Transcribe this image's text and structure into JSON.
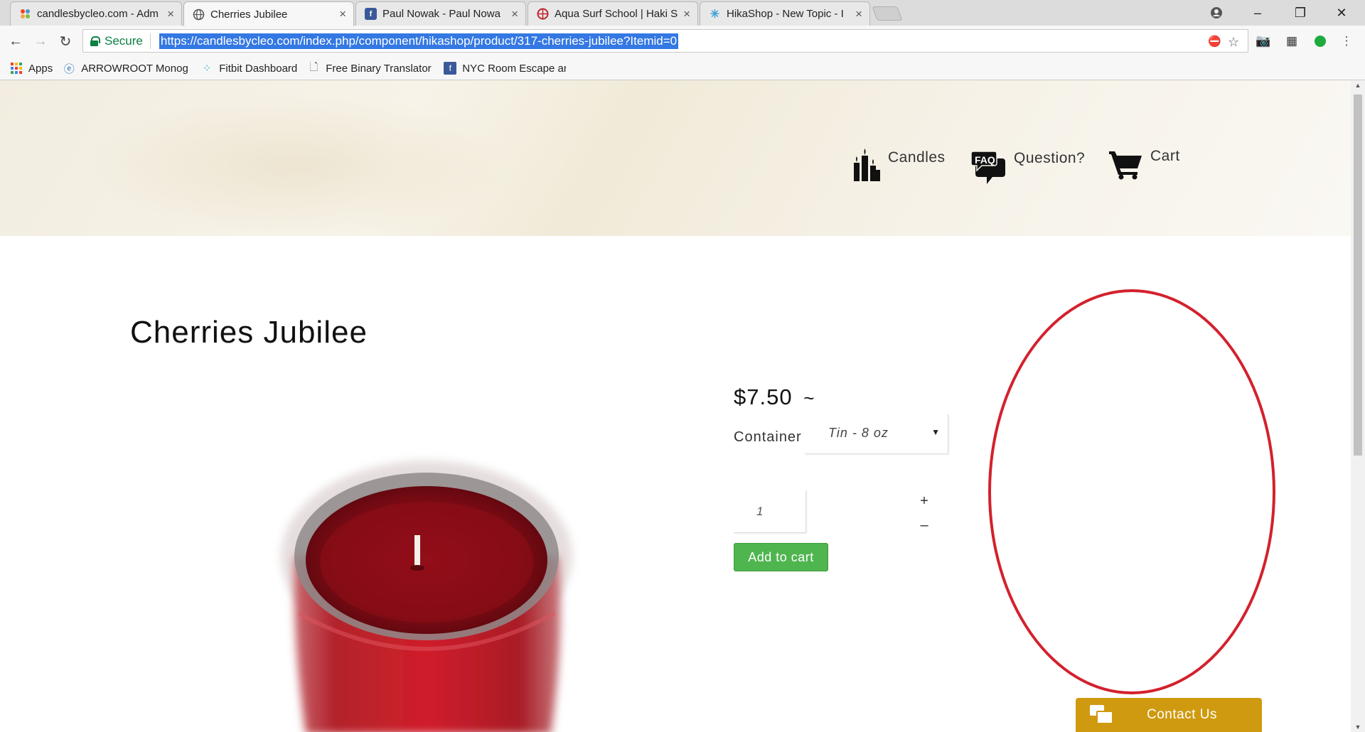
{
  "browser": {
    "tabs": [
      {
        "title": "candlesbycleo.com - Adm",
        "icon": "joomla-icon"
      },
      {
        "title": "Cherries Jubilee",
        "icon": "globe-icon"
      },
      {
        "title": "Paul Nowak - Paul Nowa",
        "icon": "facebook-icon"
      },
      {
        "title": "Aqua Surf School | Haki S",
        "icon": "surf-icon"
      },
      {
        "title": "HikaShop - New Topic - I",
        "icon": "hikashop-icon"
      }
    ],
    "security_label": "Secure",
    "url": "https://candlesbycleo.com/index.php/component/hikashop/product/317-cherries-jubilee?Itemid=0",
    "bookmarks": [
      {
        "label": "Apps",
        "icon": "apps-icon"
      },
      {
        "label": "ARROWROOT Monog",
        "icon": "arrowroot-icon"
      },
      {
        "label": "Fitbit Dashboard",
        "icon": "fitbit-icon"
      },
      {
        "label": "Free Binary Translator",
        "icon": "page-icon"
      },
      {
        "label": "NYC Room Escape an",
        "icon": "facebook-icon"
      }
    ]
  },
  "site": {
    "nav": [
      {
        "label": "Candles",
        "icon": "candles-icon"
      },
      {
        "label": "Question?",
        "icon": "faq-icon",
        "icon_text": "FAQ"
      },
      {
        "label": "Cart",
        "icon": "cart-icon"
      }
    ]
  },
  "product": {
    "title": "Cherries Jubilee",
    "price": "$7.50",
    "price_suffix": "~",
    "container_label": "Container",
    "container_value": "Tin - 8 oz",
    "quantity": "1",
    "plus": "+",
    "minus": "–",
    "add_to_cart": "Add to cart"
  },
  "contact": {
    "label": "Contact Us"
  },
  "colors": {
    "add_to_cart_bg": "#4fb54f",
    "contact_bg": "#cf9a0f",
    "annotation": "#d3212d",
    "url_highlight": "#3478e3",
    "secure_green": "#0b8043"
  }
}
